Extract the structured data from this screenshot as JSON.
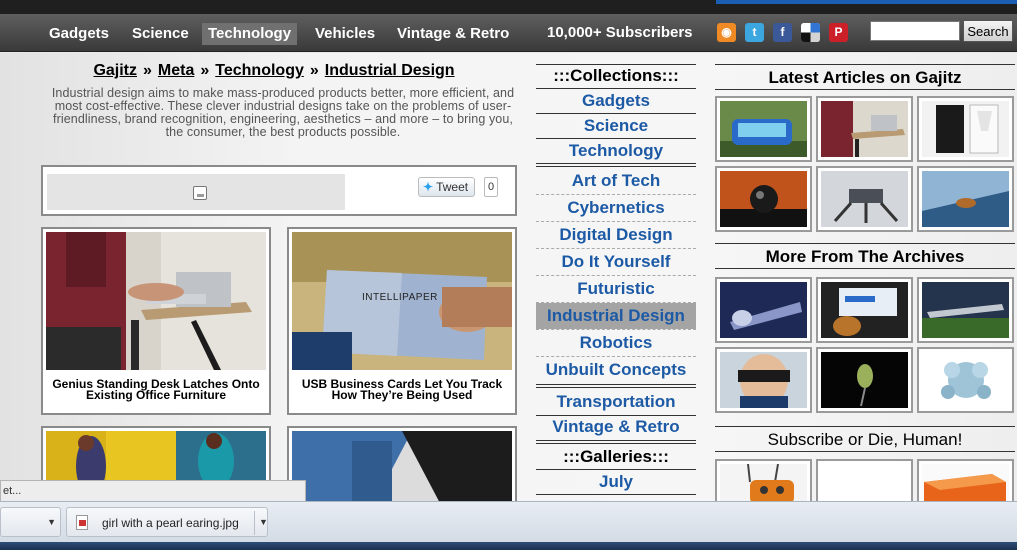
{
  "nav": {
    "items": [
      "Gadgets",
      "Science",
      "Technology",
      "Vehicles",
      "Vintage & Retro"
    ],
    "active_index": 2,
    "subscribers": "10,000+ Subscribers",
    "social_icons": [
      "rss-icon",
      "twitter-icon",
      "facebook-icon",
      "delicious-icon",
      "pinterest-icon"
    ],
    "search_value": "",
    "search_label": "Search"
  },
  "breadcrumb": {
    "items": [
      "Gajitz",
      "Meta",
      "Technology",
      "Industrial Design"
    ],
    "separator": "»"
  },
  "intro": "Industrial design aims to make mass-produced products better, more efficient, and most cost-effective. These clever industrial designs take on the problems of user-friendliness, brand recognition, engineering, aesthetics – and more – to bring you, the consumer, the best products possible.",
  "share": {
    "tweet_label": "Tweet",
    "tweet_count": "0"
  },
  "articles": [
    {
      "title": "Genius Standing Desk Latches Onto Existing Office Furniture"
    },
    {
      "title": "USB Business Cards Let You Track How They’re Being Used",
      "image_text": "INTELLIPAPER"
    },
    {
      "title": ""
    },
    {
      "title": ""
    }
  ],
  "collections": {
    "heading": ":::Collections:::",
    "main": [
      "Gadgets",
      "Science",
      "Technology"
    ],
    "sub": [
      "Art of Tech",
      "Cybernetics",
      "Digital Design",
      "Do It Yourself",
      "Futuristic",
      "Industrial Design",
      "Robotics",
      "Unbuilt Concepts"
    ],
    "active": "Industrial Design",
    "extra": [
      "Transportation",
      "Vintage & Retro"
    ],
    "galleries_heading": ":::Galleries:::",
    "galleries": [
      "July"
    ]
  },
  "sidebar": {
    "latest_heading": "Latest Articles on Gajitz",
    "archives_heading": "More From The Archives",
    "subscribe_heading": "Subscribe or Die, Human!"
  },
  "status_tip": "et...",
  "download": {
    "filename": "girl with a pearl earing.jpg"
  },
  "colors": {
    "link_blue": "#1d5aa6",
    "nav_dark": "#3a3a3a",
    "active_collection_bg": "#a4a4a4"
  }
}
